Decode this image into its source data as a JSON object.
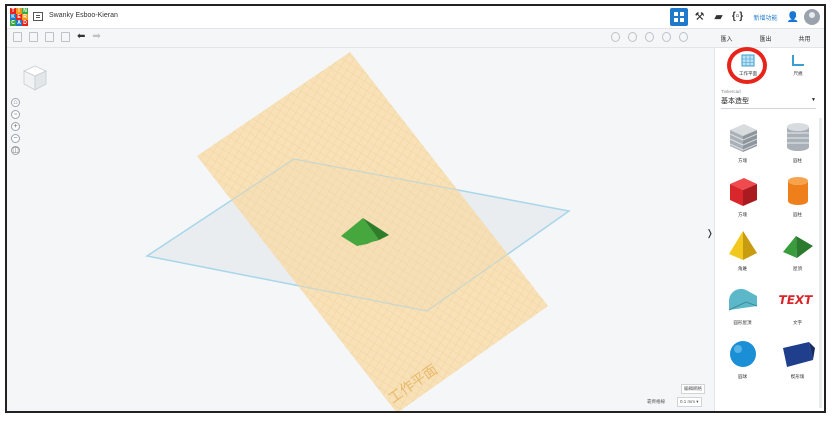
{
  "app": {
    "logo_letters": [
      "T",
      "I",
      "N",
      "K",
      "E",
      "R",
      "C",
      "A",
      "D"
    ],
    "logo_colors": [
      "#e8231a",
      "#f29b18",
      "#3da744",
      "#1f7acc",
      "#e8231a",
      "#f29b18",
      "#3da744",
      "#1f7acc",
      "#e8231a"
    ],
    "project_title": "Swanky Esboo-Kieran",
    "new_features": "新增功能"
  },
  "toolbar": {
    "undo_icon": "undo-arrow-icon",
    "redo_icon": "redo-arrow-icon"
  },
  "side_tabs": [
    "匯入",
    "匯出",
    "共用"
  ],
  "panel": {
    "workplane_label": "工作平面",
    "ruler_label": "尺規",
    "library_label": "Tinkercad",
    "library_value": "基本造型"
  },
  "shapes": [
    {
      "label": "方塊",
      "icon": "box-hole-icon",
      "color": "#a9b0b8"
    },
    {
      "label": "圓柱",
      "icon": "cylinder-hole-icon",
      "color": "#a9b0b8"
    },
    {
      "label": "方塊",
      "icon": "box-icon",
      "color": "#d9262b"
    },
    {
      "label": "圓柱",
      "icon": "cylinder-icon",
      "color": "#ef7f1a"
    },
    {
      "label": "角錐",
      "icon": "pyramid-icon",
      "color": "#f2c81e"
    },
    {
      "label": "屋頂",
      "icon": "roof-icon",
      "color": "#3a9d3d"
    },
    {
      "label": "圓形屋頂",
      "icon": "round-roof-icon",
      "color": "#5cb8c8"
    },
    {
      "label": "文字",
      "icon": "text-icon",
      "color": "#d9262b"
    },
    {
      "label": "圓球",
      "icon": "sphere-icon",
      "color": "#1a8fd6"
    },
    {
      "label": "楔形塊",
      "icon": "wedge-icon",
      "color": "#1f3e8c"
    }
  ],
  "canvas": {
    "workplane_watermark": "工作平面",
    "edit_grid": "編輯網格",
    "snap_grid_label": "靠齊格線",
    "snap_grid_value": "0.1 mm ▾"
  }
}
